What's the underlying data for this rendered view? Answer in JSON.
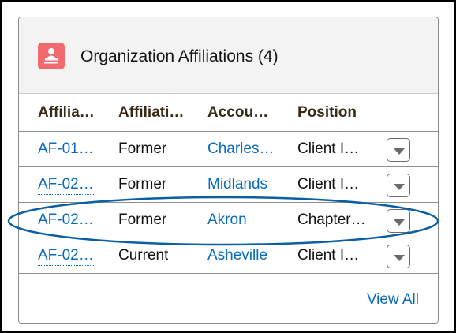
{
  "card": {
    "title": "Organization Affiliations (4)",
    "icon": "affiliation-icon"
  },
  "columns": [
    "Affilia…",
    "Affiliati…",
    "Accou…",
    "Position"
  ],
  "rows": [
    {
      "id": "AF-01…",
      "status": "Former",
      "account": "Charles…",
      "position": "Client I…"
    },
    {
      "id": "AF-02…",
      "status": "Former",
      "account": "Midlands",
      "position": "Client I…"
    },
    {
      "id": "AF-02…",
      "status": "Former",
      "account": "Akron",
      "position": "Chapter…"
    },
    {
      "id": "AF-02…",
      "status": "Current",
      "account": "Asheville",
      "position": "Client I…"
    }
  ],
  "footer": {
    "view_all": "View All"
  },
  "colors": {
    "icon_bg": "#f06a6f",
    "link": "#0b6bbd",
    "highlight": "#0b5fa5"
  }
}
